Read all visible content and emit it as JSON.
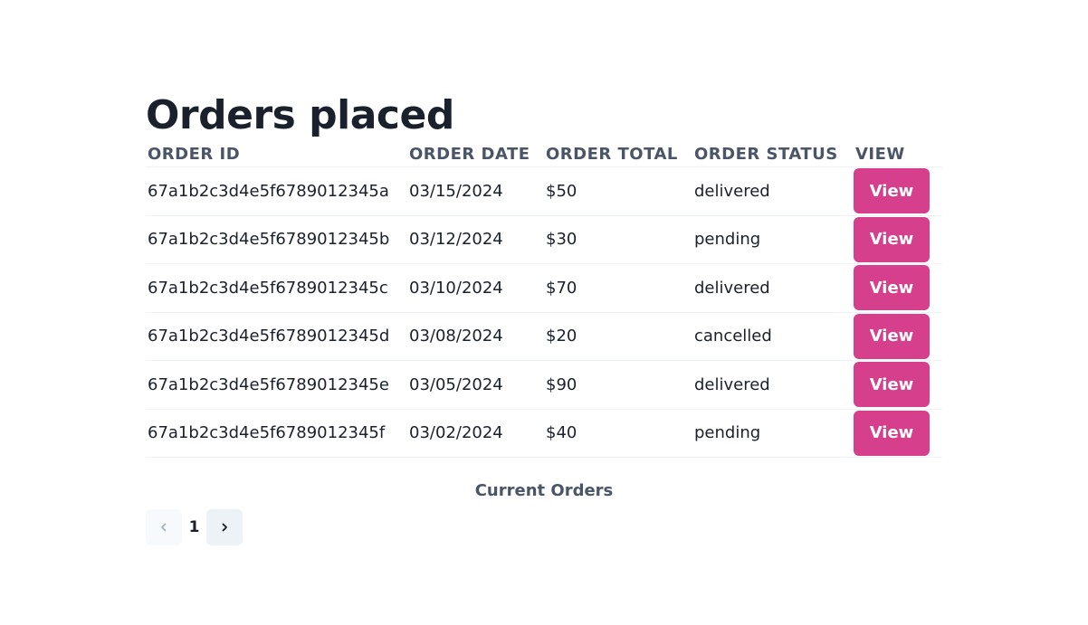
{
  "page": {
    "title": "Orders placed"
  },
  "table": {
    "headers": {
      "order_id": "ORDER ID",
      "order_date": "ORDER DATE",
      "order_total": "ORDER TOTAL",
      "order_status": "ORDER STATUS",
      "view": "VIEW"
    },
    "rows": [
      {
        "id": "67a1b2c3d4e5f6789012345a",
        "date": "03/15/2024",
        "total": "$50",
        "status": "delivered",
        "view_label": "View"
      },
      {
        "id": "67a1b2c3d4e5f6789012345b",
        "date": "03/12/2024",
        "total": "$30",
        "status": "pending",
        "view_label": "View"
      },
      {
        "id": "67a1b2c3d4e5f6789012345c",
        "date": "03/10/2024",
        "total": "$70",
        "status": "delivered",
        "view_label": "View"
      },
      {
        "id": "67a1b2c3d4e5f6789012345d",
        "date": "03/08/2024",
        "total": "$20",
        "status": "cancelled",
        "view_label": "View"
      },
      {
        "id": "67a1b2c3d4e5f6789012345e",
        "date": "03/05/2024",
        "total": "$90",
        "status": "delivered",
        "view_label": "View"
      },
      {
        "id": "67a1b2c3d4e5f6789012345f",
        "date": "03/02/2024",
        "total": "$40",
        "status": "pending",
        "view_label": "View"
      }
    ],
    "caption": "Current Orders"
  },
  "pagination": {
    "current_page": "1",
    "prev_icon": "chevron-left-icon",
    "next_icon": "chevron-right-icon",
    "prev_disabled": true
  },
  "colors": {
    "accent": "#d53f8c",
    "heading": "#1a202c",
    "muted": "#4a5568",
    "divider": "#edf2f7"
  }
}
